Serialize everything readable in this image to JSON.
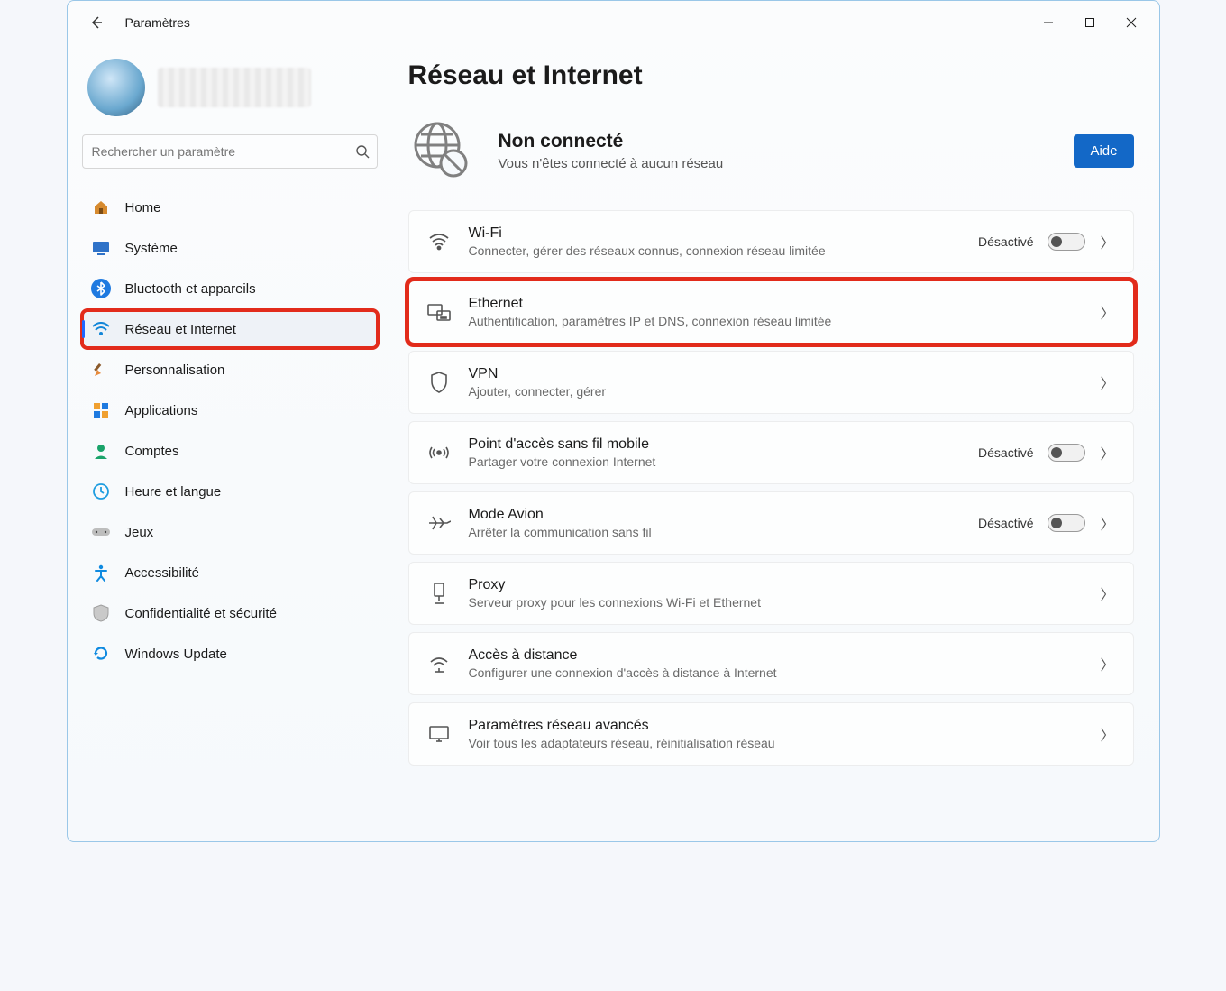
{
  "window": {
    "title": "Paramètres"
  },
  "search": {
    "placeholder": "Rechercher un paramètre"
  },
  "sidebar": {
    "items": [
      {
        "label": "Home"
      },
      {
        "label": "Système"
      },
      {
        "label": "Bluetooth et appareils"
      },
      {
        "label": "Réseau et Internet"
      },
      {
        "label": "Personnalisation"
      },
      {
        "label": "Applications"
      },
      {
        "label": "Comptes"
      },
      {
        "label": "Heure et langue"
      },
      {
        "label": "Jeux"
      },
      {
        "label": "Accessibilité"
      },
      {
        "label": "Confidentialité et sécurité"
      },
      {
        "label": "Windows Update"
      }
    ]
  },
  "page": {
    "title": "Réseau et Internet",
    "status_title": "Non connecté",
    "status_sub": "Vous n'êtes connecté à aucun réseau",
    "help": "Aide"
  },
  "cards": {
    "wifi": {
      "title": "Wi-Fi",
      "sub": "Connecter, gérer des réseaux connus, connexion réseau limitée",
      "state": "Désactivé"
    },
    "ethernet": {
      "title": "Ethernet",
      "sub": "Authentification, paramètres IP et DNS, connexion réseau limitée"
    },
    "vpn": {
      "title": "VPN",
      "sub": "Ajouter, connecter, gérer"
    },
    "hotspot": {
      "title": "Point d'accès sans fil mobile",
      "sub": "Partager votre connexion Internet",
      "state": "Désactivé"
    },
    "airplane": {
      "title": "Mode Avion",
      "sub": "Arrêter la communication sans fil",
      "state": "Désactivé"
    },
    "proxy": {
      "title": "Proxy",
      "sub": "Serveur proxy pour les connexions Wi-Fi et Ethernet"
    },
    "remote": {
      "title": "Accès à distance",
      "sub": "Configurer une connexion d'accès à distance à Internet"
    },
    "advanced": {
      "title": "Paramètres réseau avancés",
      "sub": "Voir tous les adaptateurs réseau, réinitialisation réseau"
    }
  }
}
